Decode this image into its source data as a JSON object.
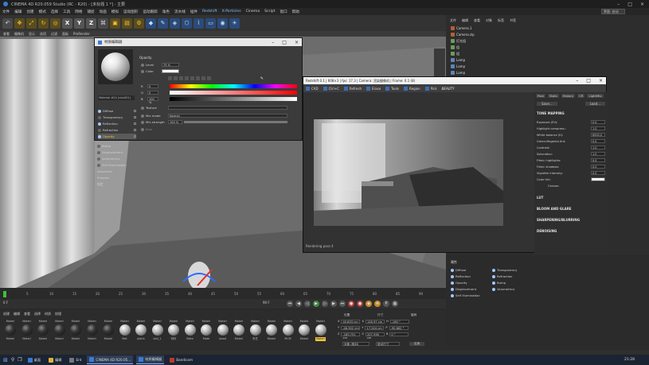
{
  "window": {
    "title": "CINEMA 4D R20.059 Studio (RC - R20) - [未标题 1 *] - 主要"
  },
  "menubar": {
    "items": [
      "文件",
      "编辑",
      "创建",
      "模式",
      "选择",
      "工具",
      "网格",
      "捕捉",
      "动画",
      "模拟",
      "运动图形",
      "运动跟踪",
      "角色",
      "流水线",
      "插件",
      "Redshift",
      "X-Particles",
      "Cinema",
      "Script",
      "窗口",
      "帮助"
    ],
    "layout_label": "界面: 启动"
  },
  "viewport": {
    "menu": [
      "查看",
      "摄像机",
      "显示",
      "选项",
      "过滤",
      "面板",
      "ProRender"
    ]
  },
  "objmgr": {
    "tabs": [
      "文件",
      "编辑",
      "查看",
      "对象",
      "标签",
      "书签"
    ],
    "rows": [
      "Camera.1",
      "Camera.zip",
      "灯光组",
      "组",
      "组",
      "Lamp",
      "Lamp",
      "Lamp"
    ]
  },
  "material_editor": {
    "title": "材质编辑器",
    "material_name": "Material #24 (ndu001)",
    "channels": [
      {
        "label": "Diffuse",
        "on": true
      },
      {
        "label": "Transparency",
        "on": false
      },
      {
        "label": "Reflection",
        "on": true
      },
      {
        "label": "Refraction",
        "on": false
      },
      {
        "label": "Opacity",
        "on": true,
        "active": true
      },
      {
        "label": "Bump",
        "on": false
      },
      {
        "label": "Displacement",
        "on": false
      },
      {
        "label": "Volumetrics",
        "on": false
      },
      {
        "label": "Self Illumination",
        "on": false
      },
      {
        "label": "Advanced",
        "on": false
      },
      {
        "label": "Preview",
        "on": false
      },
      {
        "label": "指定",
        "on": false
      }
    ],
    "opacity": {
      "header": "Opacity",
      "level_label": "Level",
      "level_value": "75 %",
      "color_label": "Color",
      "r": "0",
      "g": "0",
      "b": "100 %",
      "texture_label": "Texture",
      "mix_mode_label": "Mix mode",
      "mix_mode_value": "Normal",
      "mix_strength_label": "Mix strength",
      "mix_strength_value": "100 %",
      "size_label": "Size"
    }
  },
  "render_window": {
    "title": "Redshift 0.1 | 608×3 | fps: 17.3 | Camera: 渲染摄像机 | Frame: 0.1 (8)",
    "toolbar": [
      "CAD",
      "Ctrl+C",
      "Refresh",
      "Erase",
      "Tools",
      "Region",
      "Pick"
    ],
    "aov": "BEAUTY",
    "side_tabs": [
      "Post",
      "Stats",
      "History",
      "CR",
      "LightMix"
    ],
    "save_label": "Save...",
    "load_label": "Load...",
    "section_tone": "TONE MAPPING",
    "tone_rows": [
      {
        "label": "Exposure (EV):",
        "value": "0.0"
      },
      {
        "label": "Highlight compress.:",
        "value": "1.0"
      },
      {
        "label": "White balance (K):",
        "value": "6500.0"
      },
      {
        "label": "Green-Magenta tint:",
        "value": "0.0"
      },
      {
        "label": "Contrast:",
        "value": "1.0"
      },
      {
        "label": "Saturation:",
        "value": "1.0"
      },
      {
        "label": "Filmic highlights:",
        "value": "0.0"
      },
      {
        "label": "Filmic shadows:",
        "value": "0.0"
      },
      {
        "label": "Vignette intensity:",
        "value": "0.0"
      }
    ],
    "color_tint": "Color tint:",
    "canvas_label": "Canvas:",
    "sections": [
      "LUT",
      "BLOOM AND GLARE",
      "SHARPENING/BLURRING",
      "DENOISING"
    ],
    "status": "Rendering pass 4"
  },
  "attr": {
    "title": "属性",
    "rows_left": [
      "Diffuse",
      "Reflection",
      "Opacity",
      "Displacement",
      "Self Illumination"
    ],
    "rows_right": [
      "Transparency",
      "Refraction",
      "Bump",
      "Volumetrics"
    ]
  },
  "timeline": {
    "frames": [
      "0",
      "5",
      "10",
      "15",
      "20",
      "25",
      "30",
      "35",
      "40",
      "45",
      "50",
      "55",
      "60",
      "65",
      "70",
      "75",
      "80",
      "85",
      "90"
    ],
    "start": "0 F",
    "end": "90 F"
  },
  "matmgr": {
    "menu": [
      "创建",
      "编辑",
      "查看",
      "选择",
      "材质",
      "纹理"
    ],
    "materials": [
      {
        "top": "Materi",
        "bottom": "Materi",
        "dark": true
      },
      {
        "top": "Materi",
        "bottom": "Materi",
        "dark": true
      },
      {
        "top": "Materi",
        "bottom": "Materi",
        "dark": true
      },
      {
        "top": "Materi",
        "bottom": "Materi",
        "dark": true
      },
      {
        "top": "Materi",
        "bottom": "Materi",
        "dark": true
      },
      {
        "top": "Materi",
        "bottom": "Materi",
        "dark": true
      },
      {
        "top": "Materi",
        "bottom": "Materi",
        "dark": true
      },
      {
        "top": "Materi",
        "bottom": "Mat",
        "dark": false
      },
      {
        "top": "Materi",
        "bottom": "platin",
        "dark": false
      },
      {
        "top": "Materi",
        "bottom": "ball_1",
        "dark": false
      },
      {
        "top": "Materi",
        "bottom": "布料",
        "dark": false
      },
      {
        "top": "Materi",
        "bottom": "Mate",
        "dark": false
      },
      {
        "top": "Materi",
        "bottom": "Mate",
        "dark": false
      },
      {
        "top": "Materi",
        "bottom": "wood",
        "dark": false
      },
      {
        "top": "Materi",
        "bottom": "Materi",
        "dark": false
      },
      {
        "top": "Materi",
        "bottom": "布艺",
        "dark": false
      },
      {
        "top": "Materi",
        "bottom": "Materi",
        "dark": false
      },
      {
        "top": "Materi",
        "bottom": "MCM",
        "dark": false
      },
      {
        "top": "Materi",
        "bottom": "Materi",
        "dark": false
      },
      {
        "top": "Materi",
        "bottom": "Materi",
        "dark": false,
        "sel": true
      }
    ]
  },
  "coords": {
    "headers": [
      "位置",
      "尺寸",
      "旋转"
    ],
    "x": [
      "40.603 cm",
      "126.97 cm",
      "-180 °"
    ],
    "y": [
      "-48.902 cm",
      "17.244 cm",
      "-90.682 °"
    ],
    "z": [
      "-165.751 cm",
      "207.936 cm",
      "0 °"
    ],
    "mode": "对象 (相对)",
    "size_mode": "绝对尺寸",
    "apply": "应用"
  },
  "taskbar": {
    "items": [
      "桌面",
      "编辑",
      "Ent",
      "CINEMA 4D R20.05...",
      "材质编辑器",
      "Bandicam"
    ],
    "time": "21:28"
  }
}
